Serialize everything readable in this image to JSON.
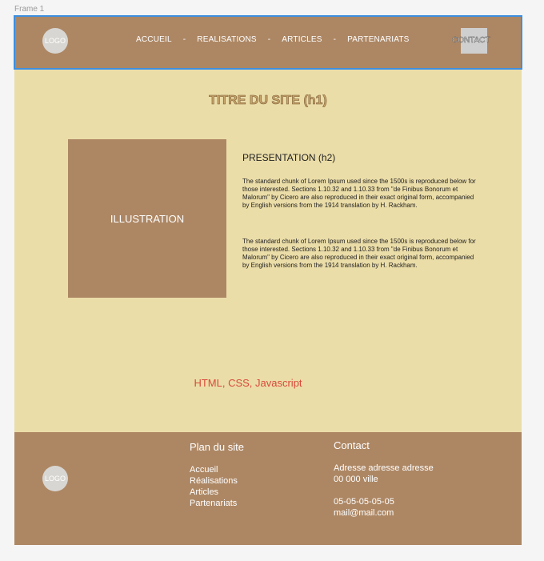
{
  "frame": {
    "label": "Frame 1"
  },
  "header": {
    "logo": "LOGO",
    "nav": [
      {
        "label": "ACCUEIL"
      },
      {
        "label": "REALISATIONS"
      },
      {
        "label": "ARTICLES"
      },
      {
        "label": "PARTENARIATS"
      }
    ],
    "separator": "-",
    "contact": "CONTACT"
  },
  "main": {
    "title": "TITRE DU SITE (h1)",
    "illustration": "ILLUSTRATION",
    "presentation_title": "PRESENTATION (h2)",
    "paragraphs": [
      "The standard chunk of Lorem Ipsum used since the 1500s is reproduced below for those interested. Sections 1.10.32 and 1.10.33 from \"de Finibus Bonorum et Malorum\" by Cicero are also reproduced in their exact original form, accompanied by English versions from the 1914 translation by H. Rackham.",
      "The standard chunk of Lorem Ipsum used since the 1500s is reproduced below for those interested. Sections 1.10.32 and 1.10.33 from \"de Finibus Bonorum et Malorum\" by Cicero are also reproduced in their exact original form, accompanied by English versions from the 1914 translation by H. Rackham."
    ],
    "tech": "HTML, CSS, Javascript"
  },
  "footer": {
    "logo": "LOGO",
    "plan_title": "Plan du site",
    "plan_links": [
      "Accueil",
      "Réalisations",
      "Articles",
      "Partenariats"
    ],
    "contact_title": "Contact",
    "address_line1": "Adresse adresse adresse",
    "address_line2": "00 000 ville",
    "phone": "05-05-05-05-05",
    "email": "mail@mail.com"
  },
  "colors": {
    "header_bg": "#ad8764",
    "page_bg": "#ebdda8",
    "footer_bg": "#ad8764",
    "selection_outline": "#3d8fe0",
    "tech_text": "#d84a3a"
  }
}
